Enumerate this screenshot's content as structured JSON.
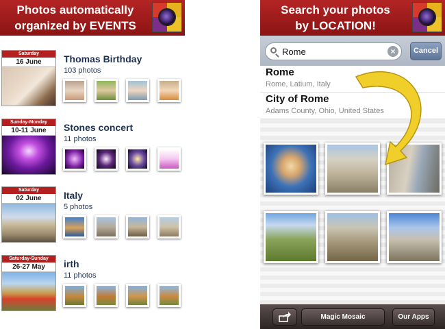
{
  "left_banner": {
    "line1": "Photos automatically",
    "line2": "organized by EVENTS"
  },
  "events": [
    {
      "day": "Saturday",
      "date": "16 June",
      "title": "Thomas Birthday",
      "count": "103 photos"
    },
    {
      "day": "Sunday-Monday",
      "date": "10-11 June",
      "title": "Stones concert",
      "count": "11 photos"
    },
    {
      "day": "Saturday",
      "date": "02 June",
      "title": "Italy",
      "count": "5 photos"
    },
    {
      "day": "Saturday-Sunday",
      "date": "26-27 May",
      "title": "irth",
      "count": "11 photos"
    }
  ],
  "right_banner": {
    "line1": "Search your photos",
    "line2": "by LOCATION!"
  },
  "search": {
    "value": "Rome",
    "cancel_label": "Cancel",
    "clear_glyph": "×"
  },
  "results": [
    {
      "title": "Rome",
      "subtitle": "Rome, Latium, Italy"
    },
    {
      "title": "City of Rome",
      "subtitle": "Adams County, Ohio, United States"
    }
  ],
  "toolbar": {
    "share_icon": "share-icon",
    "magic_label": "Magic Mosaic",
    "apps_label": "Our Apps"
  },
  "colors": {
    "banner": "#a01c1c",
    "calendar_header": "#b41f1f",
    "title_text": "#1d3150",
    "arrow": "#f0cf2a"
  }
}
